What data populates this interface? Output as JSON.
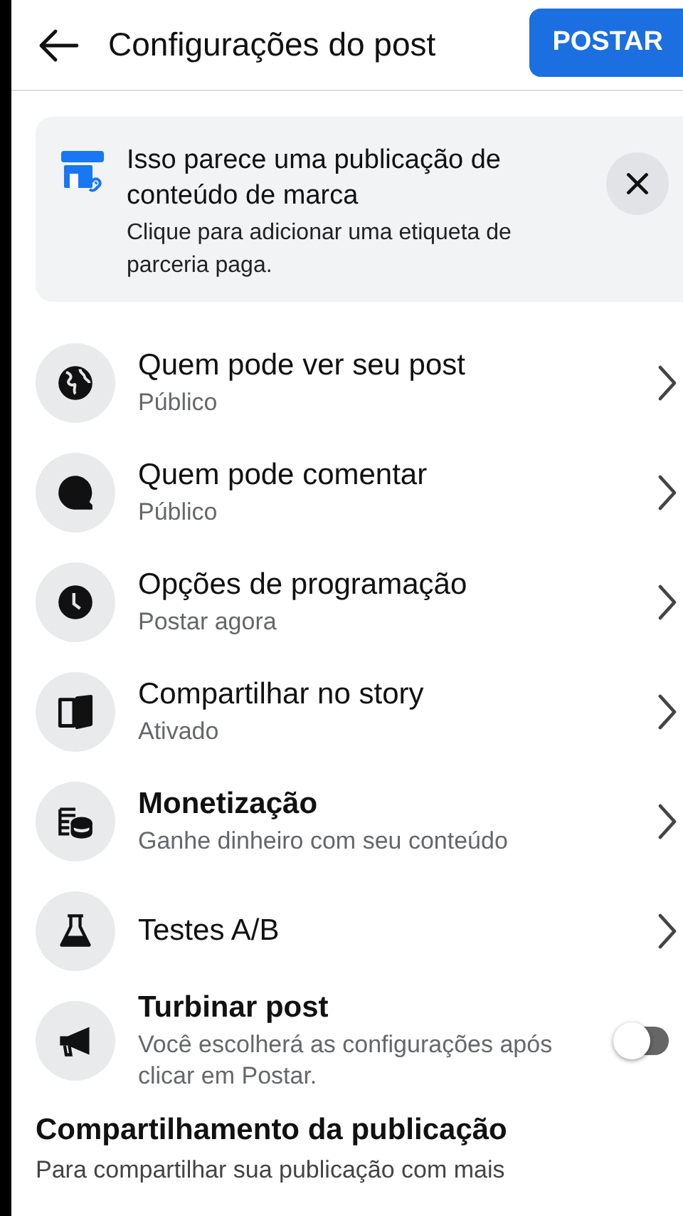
{
  "header": {
    "title": "Configurações do post",
    "post_button": "POSTAR"
  },
  "banner": {
    "title": "Isso parece uma publicação de conteúdo de marca",
    "text": "Clique para adicionar uma etiqueta de parceria paga."
  },
  "settings": [
    {
      "kind": "chevron",
      "title": "Quem pode ver seu post",
      "subtitle": "Público",
      "bold": false
    },
    {
      "kind": "chevron",
      "title": "Quem pode comentar",
      "subtitle": "Público",
      "bold": false
    },
    {
      "kind": "chevron",
      "title": "Opções de programação",
      "subtitle": "Postar agora",
      "bold": false
    },
    {
      "kind": "chevron",
      "title": "Compartilhar no story",
      "subtitle": "Ativado",
      "bold": false
    },
    {
      "kind": "chevron",
      "title": "Monetização",
      "subtitle": "Ganhe dinheiro com seu conteúdo",
      "bold": true
    },
    {
      "kind": "chevron",
      "title": "Testes A/B",
      "bold": false
    },
    {
      "kind": "toggle",
      "title": "Turbinar post",
      "subtitle": "Você escolherá as configurações após clicar em Postar.",
      "bold": true,
      "on": false
    }
  ],
  "sharing": {
    "heading": "Compartilhamento da publicação",
    "text": "Para compartilhar sua publicação com mais"
  }
}
